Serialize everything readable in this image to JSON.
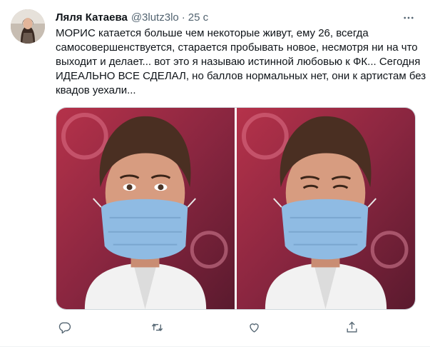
{
  "tweet": {
    "author_name": "Ляля Катаева",
    "handle": "@3lutz3lo",
    "separator": "·",
    "time": "25 с",
    "text_lines": [
      "МОРИС  катается больше чем некоторые живут, ему 26, всегда",
      "самосовершенствуется, старается пробывать новое, несмотря ни на что",
      "выходит и делает... вот это я называю истинной любовью к ФК... Сегодня",
      "ИДЕАЛЬНО ВСЕ СДЕЛАЛ, но баллов нормальных нет, они к артистам без",
      "квадов уехали..."
    ]
  },
  "icons": {
    "more": "more-icon",
    "reply": "reply-icon",
    "retweet": "retweet-icon",
    "like": "like-icon",
    "share": "share-icon"
  },
  "colors": {
    "text": "#0f1419",
    "secondary": "#536471",
    "border": "#cfd9de"
  }
}
